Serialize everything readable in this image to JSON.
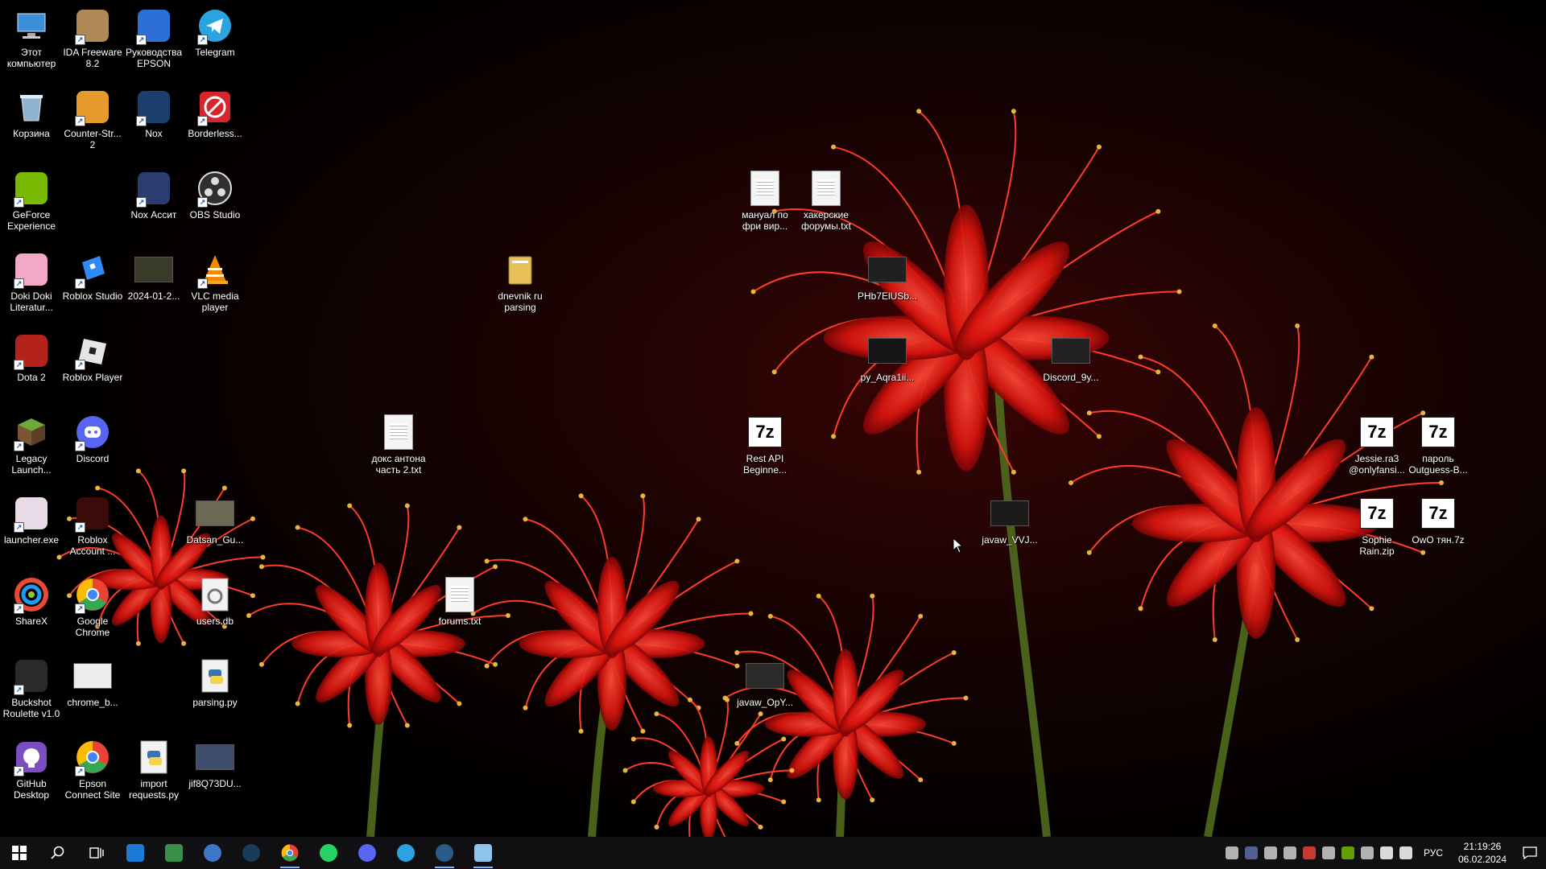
{
  "desktop": {
    "icons": [
      {
        "label": "Этот компьютер",
        "icon": "computer-icon",
        "color": "#3b8fd8",
        "shortcut": false
      },
      {
        "label": "IDA Freeware 8.2",
        "icon": "ida-icon",
        "color": "#b08a56",
        "shortcut": true
      },
      {
        "label": "Руководства EPSON",
        "icon": "epson-manual-icon",
        "color": "#2d6fd6",
        "shortcut": true
      },
      {
        "label": "Telegram",
        "icon": "telegram-icon",
        "color": "#2aa3e0",
        "shortcut": true
      },
      {
        "label": "Корзина",
        "icon": "recycle-bin-icon",
        "color": "#9fc6e6",
        "shortcut": false
      },
      {
        "label": "Counter-Str... 2",
        "icon": "counter-strike-icon",
        "color": "#e59a2b",
        "shortcut": true
      },
      {
        "label": "Nox",
        "icon": "nox-icon",
        "color": "#1d3f6e",
        "shortcut": true
      },
      {
        "label": "Borderless...",
        "icon": "borderless-icon",
        "color": "#d7262b",
        "shortcut": true
      },
      {
        "label": "GeForce Experience",
        "icon": "geforce-icon",
        "color": "#76b900",
        "shortcut": true
      },
      {
        "label": "Nox Ассит",
        "icon": "nox-assist-icon",
        "color": "#2b3c70",
        "shortcut": true
      },
      {
        "label": "OBS Studio",
        "icon": "obs-icon",
        "color": "#302e31",
        "shortcut": true
      },
      {
        "label": "Doki Doki Literatur...",
        "icon": "doki-doki-icon",
        "color": "#f3a8c8",
        "shortcut": true
      },
      {
        "label": "Roblox Studio",
        "icon": "roblox-studio-icon",
        "color": "#2f8af5",
        "shortcut": true
      },
      {
        "label": "2024-01-2...",
        "icon": "video-thumbnail-icon",
        "color": "#3a3a2a",
        "shortcut": false
      },
      {
        "label": "VLC media player",
        "icon": "vlc-icon",
        "color": "#f08a00",
        "shortcut": true
      },
      {
        "label": "Dota 2",
        "icon": "dota2-icon",
        "color": "#b3231b",
        "shortcut": true
      },
      {
        "label": "Roblox Player",
        "icon": "roblox-player-icon",
        "color": "#e6e6e6",
        "shortcut": true
      },
      {
        "label": "Legacy Launch...",
        "icon": "minecraft-icon",
        "color": "#5c8c2f",
        "shortcut": true
      },
      {
        "label": "Discord",
        "icon": "discord-icon",
        "color": "#5865f2",
        "shortcut": true
      },
      {
        "label": "launcher.exe",
        "icon": "launcher-icon",
        "color": "#e9dbe7",
        "shortcut": true
      },
      {
        "label": "Roblox Account ...",
        "icon": "roblox-account-icon",
        "color": "#3a0b0b",
        "shortcut": true
      },
      {
        "label": "Datsan_Gu...",
        "icon": "image-thumbnail-icon",
        "color": "#6b6a55",
        "shortcut": false
      },
      {
        "label": "ShareX",
        "icon": "sharex-icon",
        "color": "#1e9cf0",
        "shortcut": true
      },
      {
        "label": "Google Chrome",
        "icon": "chrome-icon",
        "color": "#34a853",
        "shortcut": true
      },
      {
        "label": "users.db",
        "icon": "database-file-icon",
        "color": "#dddddd",
        "shortcut": false
      },
      {
        "label": "Buckshot Roulette v1.0",
        "icon": "buckshot-icon",
        "color": "#2a2a2a",
        "shortcut": true
      },
      {
        "label": "chrome_b...",
        "icon": "image-thumbnail-icon",
        "color": "#ececec",
        "shortcut": false
      },
      {
        "label": "parsing.py",
        "icon": "python-file-icon",
        "color": "#f5d34a",
        "shortcut": false
      },
      {
        "label": "GitHub Desktop",
        "icon": "github-desktop-icon",
        "color": "#7b4fc2",
        "shortcut": true
      },
      {
        "label": "Epson Connect Site",
        "icon": "chrome-icon",
        "color": "#34a853",
        "shortcut": true
      },
      {
        "label": "import requests.py",
        "icon": "python-file-icon",
        "color": "#f5d34a",
        "shortcut": false
      },
      {
        "label": "jif8Q73DU...",
        "icon": "image-thumbnail-icon",
        "color": "#3e4d6e",
        "shortcut": false
      },
      {
        "label": "dnevnik ru parsing",
        "icon": "folder-icon",
        "color": "#e8c05a",
        "shortcut": false
      },
      {
        "label": "докс антона часть 2.txt",
        "icon": "text-file-icon",
        "color": "#f4f4f4",
        "shortcut": false
      },
      {
        "label": "forums.txt",
        "icon": "text-file-icon",
        "color": "#f4f4f4",
        "shortcut": false
      },
      {
        "label": "мануал по фри вир...",
        "icon": "text-file-icon",
        "color": "#f4f4f4",
        "shortcut": false
      },
      {
        "label": "хакерские форумы.txt",
        "icon": "text-file-icon",
        "color": "#f4f4f4",
        "shortcut": false
      },
      {
        "label": "PHb7ElUSb...",
        "icon": "image-thumbnail-icon",
        "color": "#202020",
        "shortcut": false
      },
      {
        "label": "py_Aqra1ii...",
        "icon": "image-thumbnail-icon",
        "color": "#151515",
        "shortcut": false
      },
      {
        "label": "Discord_9y...",
        "icon": "image-thumbnail-icon",
        "color": "#222222",
        "shortcut": false
      },
      {
        "label": "Rest API Beginne...",
        "icon": "7z-archive-icon",
        "color": "#ffffff",
        "shortcut": false
      },
      {
        "label": "javaw_VVJ...",
        "icon": "image-thumbnail-icon",
        "color": "#1b1b1b",
        "shortcut": false
      },
      {
        "label": "javaw_OpY...",
        "icon": "image-thumbnail-icon",
        "color": "#2a2a2a",
        "shortcut": false
      },
      {
        "label": "Jessie.ra3 @onlyfansi...",
        "icon": "7z-archive-icon",
        "color": "#ffffff",
        "shortcut": false
      },
      {
        "label": "пароль Outguess-B...",
        "icon": "7z-archive-icon",
        "color": "#ffffff",
        "shortcut": false
      },
      {
        "label": "Sophie Rain.zip",
        "icon": "7z-archive-icon",
        "color": "#ffffff",
        "shortcut": false
      },
      {
        "label": "OwO тян.7z",
        "icon": "7z-archive-icon",
        "color": "#ffffff",
        "shortcut": false
      }
    ]
  },
  "taskbar": {
    "items": [
      {
        "icon": "windows-start-icon",
        "color": "#ffffff",
        "active": false
      },
      {
        "icon": "search-icon",
        "color": "#ffffff",
        "active": false
      },
      {
        "icon": "task-view-icon",
        "color": "#ffffff",
        "active": false
      },
      {
        "icon": "microsoft-store-icon",
        "color": "#1c7ad6",
        "active": false
      },
      {
        "icon": "app-installer-icon",
        "color": "#3a8f4a",
        "active": false
      },
      {
        "icon": "qbittorrent-icon",
        "color": "#3d78c8",
        "active": false
      },
      {
        "icon": "steam-icon",
        "color": "#1b3b5a",
        "active": false
      },
      {
        "icon": "chrome-icon",
        "color": "#34a853",
        "active": true
      },
      {
        "icon": "whatsapp-icon",
        "color": "#25d366",
        "active": false
      },
      {
        "icon": "discord-icon",
        "color": "#5865f2",
        "active": false
      },
      {
        "icon": "telegram-icon",
        "color": "#2aa3e0",
        "active": false
      },
      {
        "icon": "steam-icon",
        "color": "#2a5a8a",
        "active": true
      },
      {
        "icon": "notepad-icon",
        "color": "#8ec6f0",
        "active": true
      }
    ],
    "tray": {
      "icons": [
        {
          "icon": "discord-tray-icon",
          "color": "#cfcfcf"
        },
        {
          "icon": "nox-tray-icon",
          "color": "#5c6ea8"
        },
        {
          "icon": "steam-tray-icon",
          "color": "#cfcfcf"
        },
        {
          "icon": "nvidia-tray-icon",
          "color": "#cfcfcf"
        },
        {
          "icon": "chrome-tray-icon",
          "color": "#e94235"
        },
        {
          "icon": "steam-tray-icon",
          "color": "#cfcfcf"
        },
        {
          "icon": "geforce-tray-icon",
          "color": "#76b900"
        },
        {
          "icon": "usb-tray-icon",
          "color": "#cfcfcf"
        },
        {
          "icon": "network-icon",
          "color": "#ffffff"
        },
        {
          "icon": "volume-icon",
          "color": "#ffffff"
        }
      ],
      "language": "РУС",
      "time": "21:19:26",
      "date": "06.02.2024"
    }
  }
}
